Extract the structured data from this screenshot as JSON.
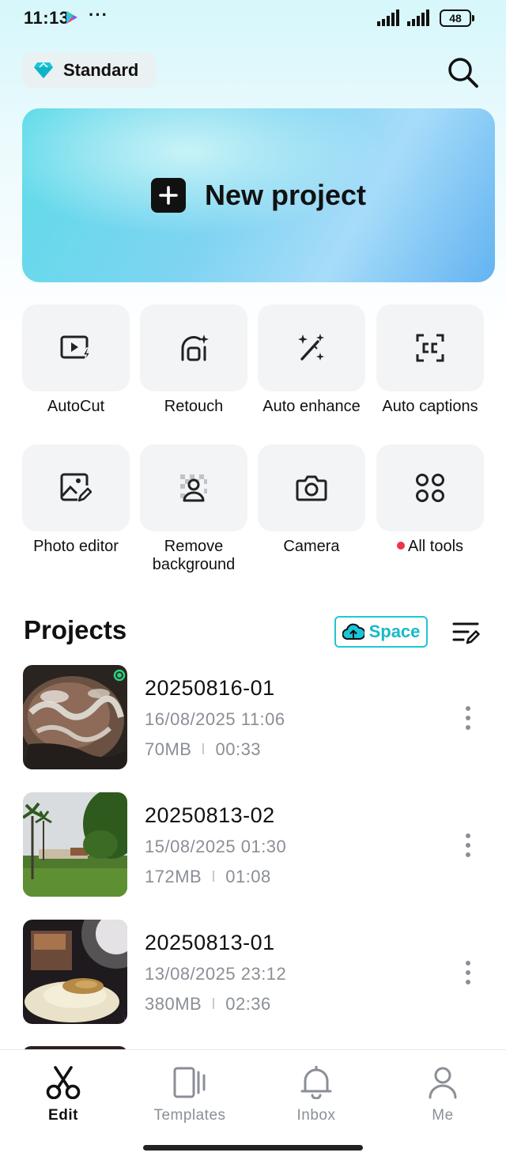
{
  "status_bar": {
    "time": "11:13",
    "battery": "48"
  },
  "header": {
    "plan_label": "Standard"
  },
  "new_project": {
    "label": "New project"
  },
  "tools": [
    {
      "label": "AutoCut",
      "icon": "autocut-icon"
    },
    {
      "label": "Retouch",
      "icon": "retouch-icon"
    },
    {
      "label": "Auto enhance",
      "icon": "magic-wand-icon"
    },
    {
      "label": "Auto captions",
      "icon": "captions-icon"
    },
    {
      "label": "Photo editor",
      "icon": "photo-editor-icon"
    },
    {
      "label": "Remove background",
      "icon": "remove-background-icon"
    },
    {
      "label": "Camera",
      "icon": "camera-icon"
    },
    {
      "label": "All tools",
      "icon": "grid-icon"
    }
  ],
  "projects": {
    "title": "Projects",
    "space_label": "Space",
    "items": [
      {
        "name": "20250816-01",
        "date": "16/08/2025 11:06",
        "size": "70MB",
        "duration": "00:33"
      },
      {
        "name": "20250813-02",
        "date": "15/08/2025 01:30",
        "size": "172MB",
        "duration": "01:08"
      },
      {
        "name": "20250813-01",
        "date": "13/08/2025 23:12",
        "size": "380MB",
        "duration": "02:36"
      }
    ]
  },
  "bottom_nav": [
    {
      "label": "Edit",
      "icon": "scissors-icon",
      "active": true
    },
    {
      "label": "Templates",
      "icon": "templates-icon",
      "active": false
    },
    {
      "label": "Inbox",
      "icon": "bell-icon",
      "active": false
    },
    {
      "label": "Me",
      "icon": "person-icon",
      "active": false
    }
  ],
  "colors": {
    "accent": "#20c7d6",
    "notification_dot": "#f0334a",
    "muted_text": "#8a8f96"
  }
}
